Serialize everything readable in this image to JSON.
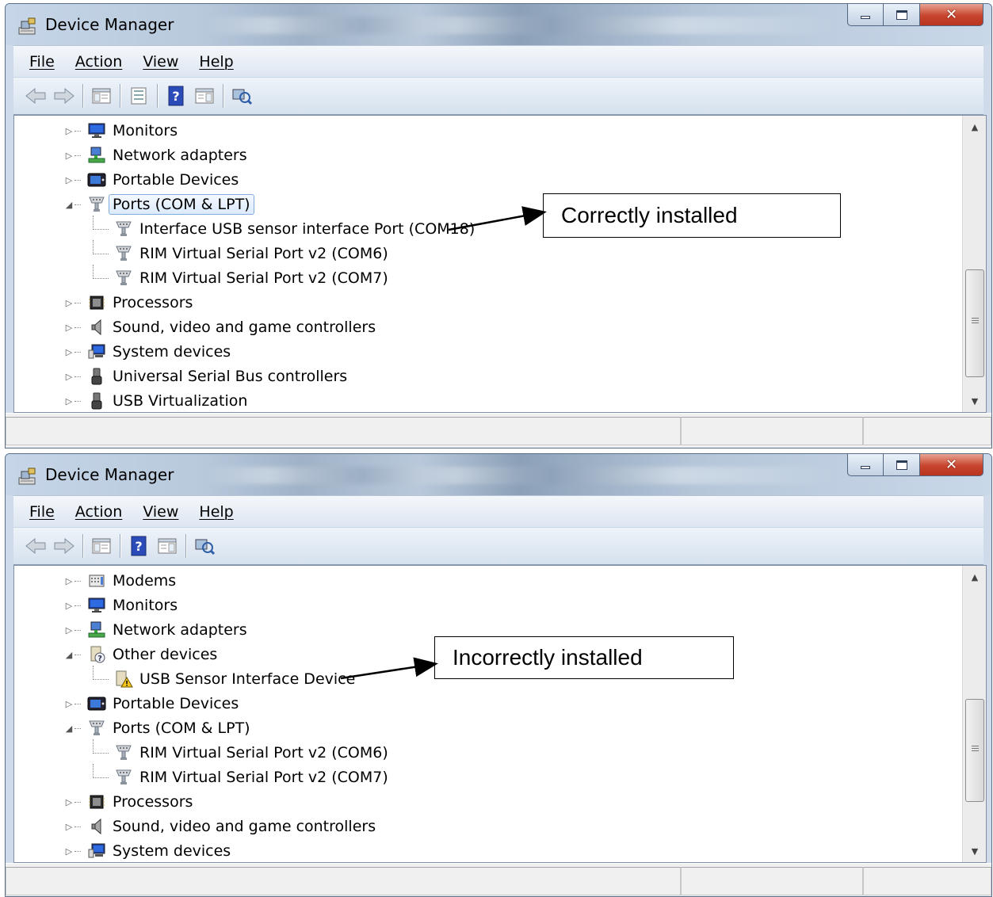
{
  "windows": [
    {
      "title": "Device Manager",
      "menu": [
        "File",
        "Action",
        "View",
        "Help"
      ],
      "tree": [
        {
          "label": "Monitors",
          "icon": "monitor-icon",
          "expanded": false
        },
        {
          "label": "Network adapters",
          "icon": "network-adapter-icon",
          "expanded": false
        },
        {
          "label": "Portable Devices",
          "icon": "portable-device-icon",
          "expanded": false
        },
        {
          "label": "Ports (COM & LPT)",
          "icon": "port-icon",
          "expanded": true,
          "selected": true
        },
        {
          "label": "Interface USB sensor interface Port (COM18)",
          "icon": "port-icon",
          "child": true
        },
        {
          "label": "RIM Virtual Serial Port v2 (COM6)",
          "icon": "port-icon",
          "child": true
        },
        {
          "label": "RIM Virtual Serial Port v2 (COM7)",
          "icon": "port-icon",
          "child": true
        },
        {
          "label": "Processors",
          "icon": "processor-icon",
          "expanded": false
        },
        {
          "label": "Sound, video and game controllers",
          "icon": "speaker-icon",
          "expanded": false
        },
        {
          "label": "System devices",
          "icon": "system-devices-icon",
          "expanded": false
        },
        {
          "label": "Universal Serial Bus controllers",
          "icon": "usb-icon",
          "expanded": false
        },
        {
          "label": "USB Virtualization",
          "icon": "usb-icon",
          "expanded": false
        }
      ],
      "callout": "Correctly installed"
    },
    {
      "title": "Device Manager",
      "menu": [
        "File",
        "Action",
        "View",
        "Help"
      ],
      "tree": [
        {
          "label": "Modems",
          "icon": "modem-icon",
          "expanded": false
        },
        {
          "label": "Monitors",
          "icon": "monitor-icon",
          "expanded": false
        },
        {
          "label": "Network adapters",
          "icon": "network-adapter-icon",
          "expanded": false
        },
        {
          "label": "Other devices",
          "icon": "unknown-device-icon",
          "expanded": true
        },
        {
          "label": "USB Sensor Interface Device",
          "icon": "warning-device-icon",
          "child": true
        },
        {
          "label": "Portable Devices",
          "icon": "portable-device-icon",
          "expanded": false
        },
        {
          "label": "Ports (COM & LPT)",
          "icon": "port-icon",
          "expanded": true
        },
        {
          "label": "RIM Virtual Serial Port v2 (COM6)",
          "icon": "port-icon",
          "child": true
        },
        {
          "label": "RIM Virtual Serial Port v2 (COM7)",
          "icon": "port-icon",
          "child": true
        },
        {
          "label": "Processors",
          "icon": "processor-icon",
          "expanded": false
        },
        {
          "label": "Sound, video and game controllers",
          "icon": "speaker-icon",
          "expanded": false
        },
        {
          "label": "System devices",
          "icon": "system-devices-icon",
          "expanded": false
        }
      ],
      "callout": "Incorrectly installed"
    }
  ],
  "colors": {
    "title_gradient": "#b8c9dc",
    "close_button": "#c7452d",
    "selection": "#dceafc"
  }
}
